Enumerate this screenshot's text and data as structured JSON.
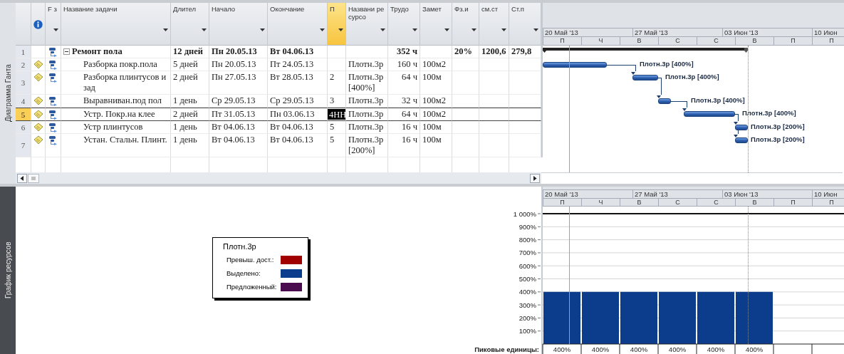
{
  "gantt": {
    "view_label": "Диаграмма Ганта",
    "mode_header": "F з",
    "columns": [
      {
        "label": "Название задачи",
        "selected": false
      },
      {
        "label": "Длител",
        "selected": false
      },
      {
        "label": "Начало",
        "selected": false
      },
      {
        "label": "Окончание",
        "selected": false
      },
      {
        "label": "П",
        "selected": true
      },
      {
        "label": "Названи ресурсо",
        "selected": false
      },
      {
        "label": "Трудо",
        "selected": false
      },
      {
        "label": "Замет",
        "selected": false
      },
      {
        "label": "Фз.и",
        "selected": false
      },
      {
        "label": "см.ст",
        "selected": false
      },
      {
        "label": "Ст.п",
        "selected": false
      }
    ],
    "timescale": {
      "weeks": [
        "20 Май '13",
        "27 Май '13",
        "03 Июн '13",
        "10 Июн"
      ],
      "days": [
        "П",
        "Ч",
        "В",
        "С",
        "С",
        "В",
        "П",
        "П"
      ]
    },
    "tasks": [
      {
        "id": "1",
        "selected": false,
        "note": false,
        "expanded": true,
        "name": "Ремонт пола",
        "duration": "12 дней",
        "start": "Пн 20.05.13",
        "finish": "Вт 04.06.13",
        "work": "352 ч",
        "column_11": "20%",
        "column_12": "1200,6",
        "column_13": "279,8",
        "children": [
          {
            "id": "2",
            "selected": false,
            "note": true,
            "name": "Разборка покр.пола",
            "duration": "5 дней",
            "start": "Пн 20.05.13",
            "finish": "Пт 24.05.13",
            "resource": "Плотн.3р",
            "work": "160 ч",
            "notes": "100м2",
            "bar_label": "Плотн.3р [400%]"
          },
          {
            "id": "3",
            "selected": false,
            "note": true,
            "name": "Разборка плинтусов и зад",
            "duration": "2 дней",
            "start": "Пн 27.05.13",
            "finish": "Вт 28.05.13",
            "predecessors": "2",
            "resource": "Плотн.3р [400%]",
            "work": "64 ч",
            "notes": "100м",
            "bar_label": "Плотн.3р [400%]"
          },
          {
            "id": "4",
            "selected": false,
            "note": true,
            "name": "Выравниван.под пол",
            "duration": "1 день",
            "start": "Ср 29.05.13",
            "finish": "Ср 29.05.13",
            "predecessors": "3",
            "resource": "Плотн.3р",
            "work": "32 ч",
            "notes": "100м2",
            "bar_label": "Плотн.3р [400%]"
          },
          {
            "id": "5",
            "selected": true,
            "note": true,
            "name": "Устр. Покр.на клее",
            "duration": "2 дней",
            "start": "Пт 31.05.13",
            "finish": "Пн 03.06.13",
            "predecessors": "4НН",
            "resource": "Плотн.3р",
            "work": "64 ч",
            "notes": "100м2",
            "bar_label": "Плотн.3р [400%]"
          },
          {
            "id": "6",
            "selected": false,
            "note": true,
            "name": "Устр плинтусов",
            "duration": "1 день",
            "start": "Вт 04.06.13",
            "finish": "Вт 04.06.13",
            "predecessors": "5",
            "resource": "Плотн.3р",
            "work": "16 ч",
            "notes": "100м",
            "bar_label": "Плотн.3р [200%]"
          },
          {
            "id": "7",
            "selected": false,
            "note": true,
            "name": "Устан. Стальн. Плинт.",
            "duration": "1 день",
            "start": "Вт 04.06.13",
            "finish": "Вт 04.06.13",
            "predecessors": "5",
            "resource": "Плотн.3р [200%]",
            "work": "16 ч",
            "notes": "100м",
            "bar_label": "Плотн.3р [200%]"
          }
        ]
      }
    ]
  },
  "resource_graph": {
    "view_label": "График ресурсов",
    "legend": {
      "title": "Плотн.3р",
      "items": [
        {
          "label": "Превыш. дост.:",
          "color": "#a00000"
        },
        {
          "label": "Выделено:",
          "color": "#0c3d8c"
        },
        {
          "label": "Предложенный:",
          "color": "#4a0b4f"
        }
      ]
    },
    "weeks": [
      "20 Май '13",
      "27 Май '13",
      "03 Июн '13",
      "10 Июн"
    ],
    "days": [
      "П",
      "Ч",
      "В",
      "С",
      "С",
      "В",
      "П",
      "П"
    ],
    "chart_data": {
      "type": "bar",
      "series": [
        {
          "color": "#0c3d8c",
          "values": [
            400,
            400,
            400,
            400,
            400,
            400,
            null,
            null
          ]
        }
      ],
      "ylim": [
        0,
        1000
      ],
      "grid": true,
      "yticks": [
        {
          "value": 100,
          "label": "100%"
        },
        {
          "value": 200,
          "label": "200%"
        },
        {
          "value": 300,
          "label": "300%"
        },
        {
          "value": 400,
          "label": "400%"
        },
        {
          "value": 500,
          "label": "500%"
        },
        {
          "value": 600,
          "label": "600%"
        },
        {
          "value": 700,
          "label": "700%"
        },
        {
          "value": 800,
          "label": "800%"
        },
        {
          "value": 900,
          "label": "900%"
        },
        {
          "value": 1000,
          "label": "1 000%"
        }
      ]
    },
    "peak_label": "Пиковые единицы:",
    "peak_units": [
      "400%",
      "400%",
      "400%",
      "400%",
      "400%",
      "400%"
    ]
  }
}
